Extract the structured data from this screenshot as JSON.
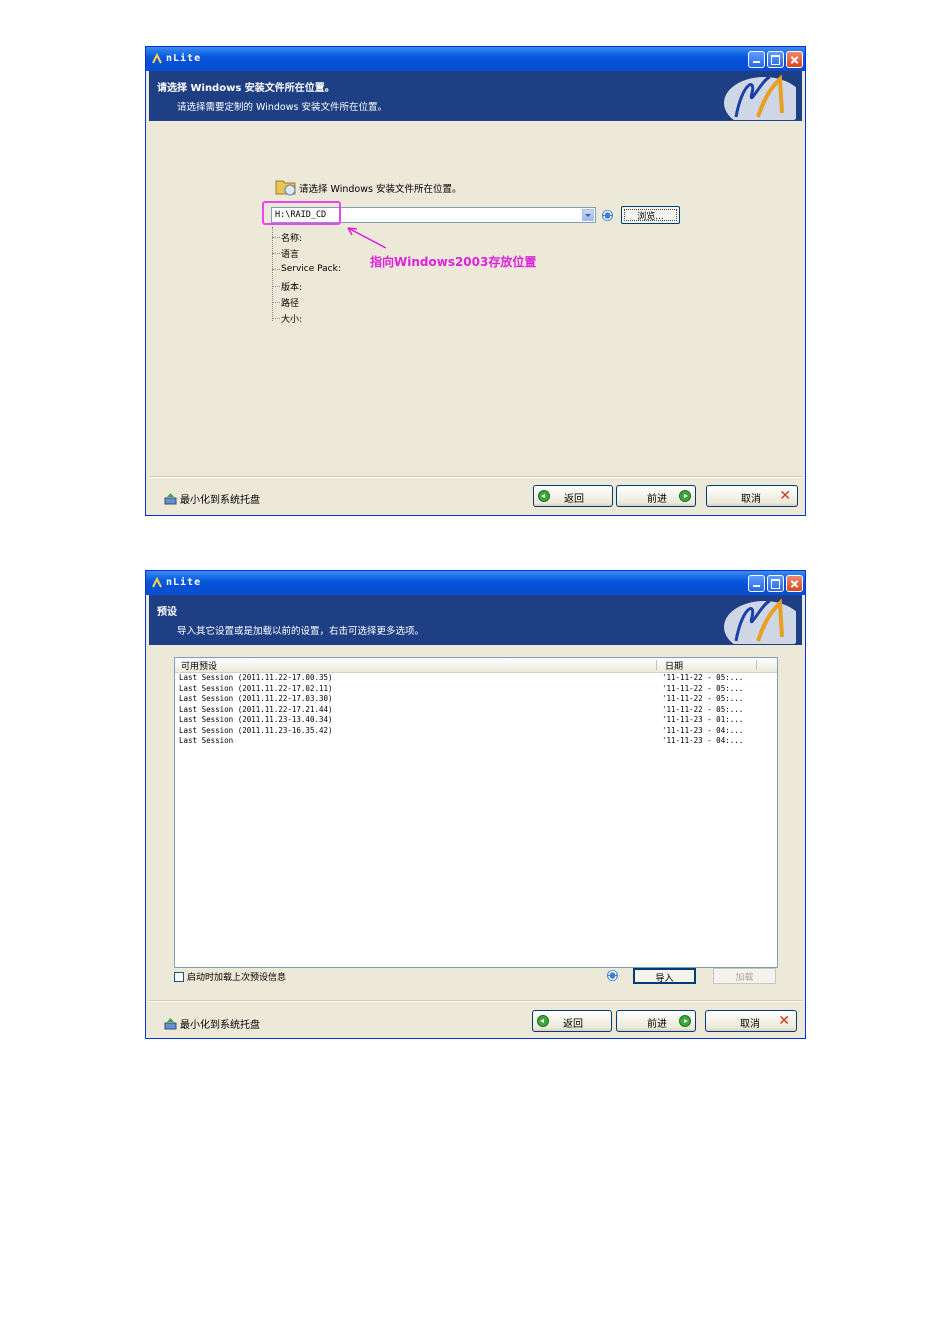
{
  "window1": {
    "title": "nLite",
    "header": {
      "title": "请选择 Windows 安装文件所在位置。",
      "subtitle": "请选择需要定制的 Windows 安装文件所在位置。"
    },
    "prompt": "请选择 Windows 安装文件所在位置。",
    "path_value": "H:\\RAID_CD",
    "browse_label": "浏览...",
    "annotation": "指向Windows2003存放位置",
    "info_items": [
      "名称:",
      "语言",
      "Service Pack:",
      "版本:",
      "路径",
      "大小:"
    ],
    "tray_label": "最小化到系统托盘",
    "back_label": "返回",
    "next_label": "前进",
    "cancel_label": "取消"
  },
  "window2": {
    "title": "nLite",
    "header": {
      "title": "预设",
      "subtitle": "导入其它设置或是加载以前的设置，右击可选择更多选项。"
    },
    "list": {
      "columns": [
        "可用预设",
        "日期"
      ],
      "rows": [
        [
          "Last Session (2011.11.22-17.00.35)",
          "'11-11-22 - 05:..."
        ],
        [
          "Last Session (2011.11.22-17.02.11)",
          "'11-11-22 - 05:..."
        ],
        [
          "Last Session (2011.11.22-17.03.30)",
          "'11-11-22 - 05:..."
        ],
        [
          "Last Session (2011.11.22-17.21.44)",
          "'11-11-22 - 05:..."
        ],
        [
          "Last Session (2011.11.23-13.40.34)",
          "'11-11-23 - 01:..."
        ],
        [
          "Last Session (2011.11.23-16.35.42)",
          "'11-11-23 - 04:..."
        ],
        [
          "Last Session",
          "'11-11-23 - 04:..."
        ]
      ]
    },
    "autoload_label": "启动时加载上次预设信息",
    "import_label": "导入",
    "load_label": "加载",
    "tray_label": "最小化到系统托盘",
    "back_label": "返回",
    "next_label": "前进",
    "cancel_label": "取消"
  },
  "colors": {
    "titlebar": "#0a5ae0",
    "header": "#1f3f85",
    "window_bg": "#ece9d8",
    "annotation": "#dd22dd",
    "nav_green": "#3ca83c",
    "cancel_red": "#d4361a"
  },
  "icons": [
    "nlite-icon",
    "minimize-icon",
    "maximize-icon",
    "close-icon",
    "nlite-logo-icon",
    "folder-icon",
    "dropdown-arrow-icon",
    "refresh-icon",
    "annotation-arrow-icon",
    "tray-icon",
    "back-arrow-icon",
    "forward-arrow-icon",
    "cancel-x-icon",
    "checkbox-icon"
  ]
}
